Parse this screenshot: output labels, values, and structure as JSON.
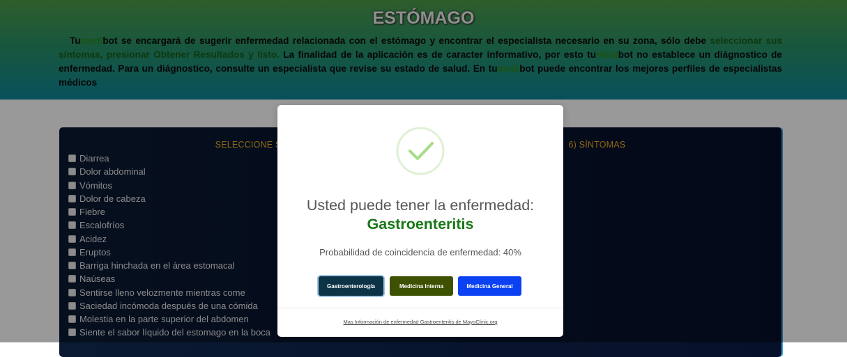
{
  "header": {
    "title": "ESTÓMAGO",
    "intro_parts": [
      "Tu",
      "medi",
      "bot se encargará de sugerir enfermedad relacionada con el estómago y encontrar el especialista necesario en su zona, sólo debe ",
      "seleccionar sus síntomas, presionar Obtener Resultados y listo.",
      " La finalidad de la aplicación es de caracter informativo, por esto tu",
      "medi",
      "bot no establece un diágnostico de enfermedad. Para un diágnostico, consulte un especialista que revise su estado de salud. En tu",
      "medi",
      "bot puede encontrar los mejores perfiles de especialistas médicos"
    ]
  },
  "symptoms_panel": {
    "heading_left": "SELECCIONE S",
    "heading_right": "6) SÍNTOMAS",
    "items": [
      "Diarrea",
      "Dolor abdominal",
      "Vómitos",
      "Dolor de cabeza",
      "Fiebre",
      "Escalofríos",
      "Acidez",
      "Eruptos",
      "Barriga hinchada en el área estomacal",
      "Naúseas",
      "Sentirse lleno velozmente mientras come",
      "Saciedad incómoda después de una cómida",
      "Molestia en la parte superior del abdomen",
      "Siente el sabor líquido del estomago en la boca"
    ]
  },
  "modal": {
    "title_prefix": "Usted puede tener la enfermedad:",
    "disease": "Gastroenteritis",
    "probability_text": "Probabilidad de coincidencia de enfermedad: 40%",
    "buttons": {
      "gastro": "Gastroenterología",
      "interna": "Medicina Interna",
      "general": "Medicina General"
    },
    "info_link": "Mas Información de enfermedad Gastroenteritis de MayoClinic.org",
    "icon": "success-check-icon"
  },
  "colors": {
    "brand_green": "#2d8a1d",
    "disease_green": "#187716",
    "heading_orange": "#f2b01e",
    "btn_gastro": "#0d3347",
    "btn_interna": "#3d5101",
    "btn_general": "#0b41f2"
  }
}
